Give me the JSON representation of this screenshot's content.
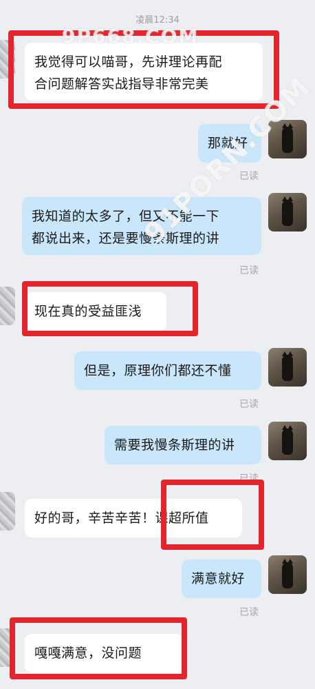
{
  "chat": {
    "timestamp": "凌晨12:34",
    "read_label": "已读",
    "messages": [
      {
        "side": "in",
        "text_line1": "我觉得可以喵哥，先讲理论再配",
        "text_line2": "合问题解答实战指导非常完美"
      },
      {
        "side": "out",
        "text": "那就好"
      },
      {
        "side": "out",
        "text_line1": "我知道的太多了，但又不能一下",
        "text_line2": "都说出来，还是要慢条斯理的讲"
      },
      {
        "side": "in",
        "text": "现在真的受益匪浅"
      },
      {
        "side": "out",
        "text": "但是，原理你们都还不懂"
      },
      {
        "side": "out",
        "text": "需要我慢条斯理的讲"
      },
      {
        "side": "in",
        "text": "好的哥，辛苦辛苦！课超所值"
      },
      {
        "side": "out",
        "text": "满意就好"
      },
      {
        "side": "in",
        "text": "嘎嘎满意，没问题"
      }
    ]
  },
  "watermarks": {
    "top": "9P668.COM",
    "diagonal": "91PORN.COM"
  },
  "colors": {
    "background": "#edeef2",
    "incoming_bubble": "#ffffff",
    "outgoing_bubble": "#c9e6fb",
    "highlight_box": "#e3262d",
    "read_text": "#a3a6ab"
  }
}
